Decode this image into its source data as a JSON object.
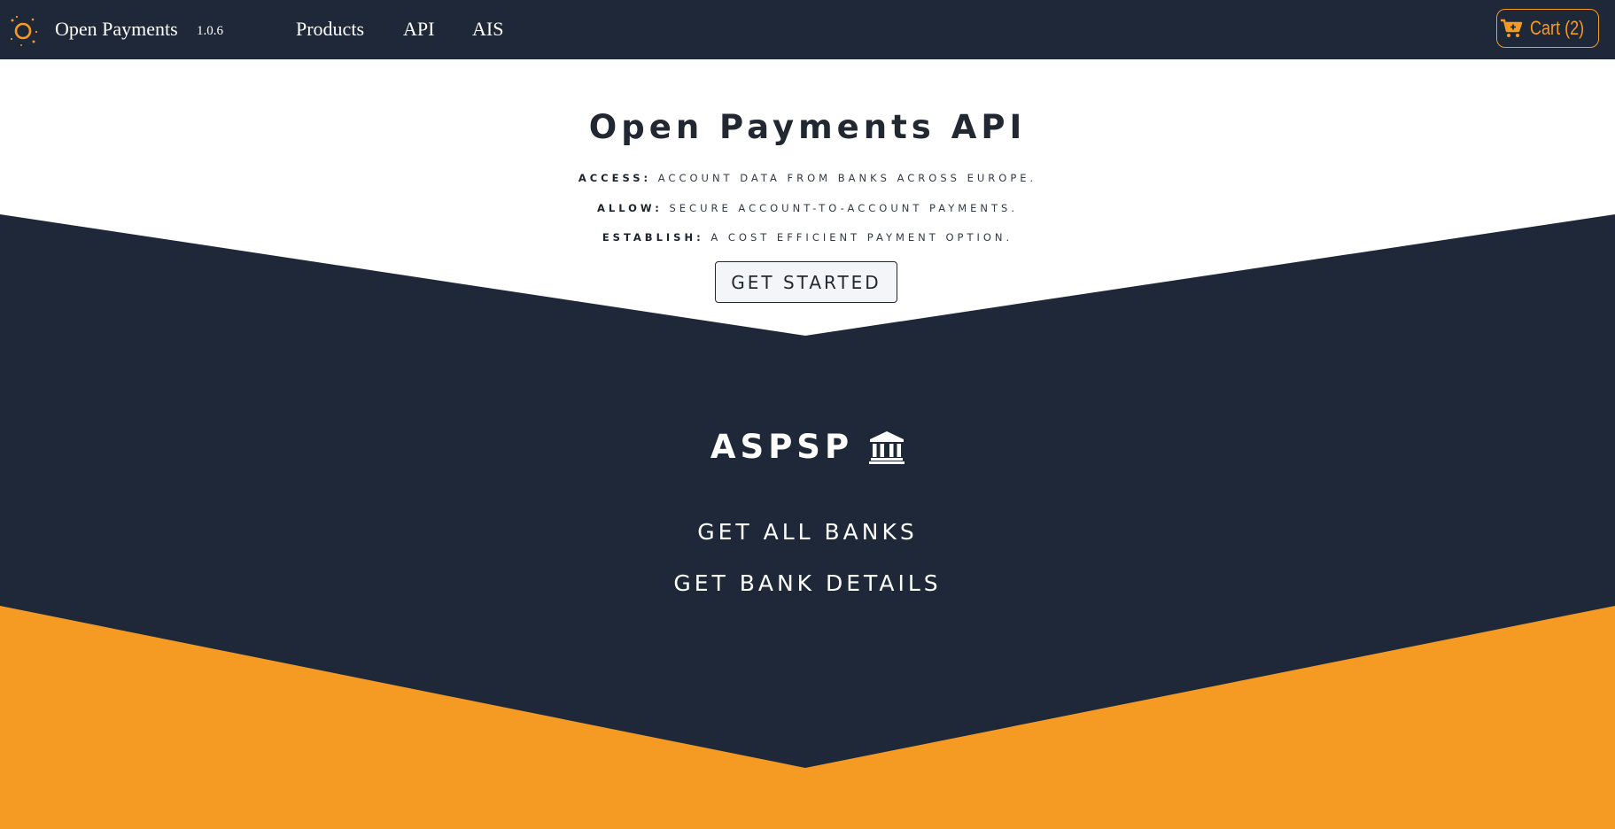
{
  "navbar": {
    "brand_name": "Open Payments",
    "brand_version": "1.0.6",
    "links": [
      "Products",
      "API",
      "AIS"
    ],
    "cart_label": "Cart (2)",
    "logo_icon": "open-payments-logo-icon",
    "cart_icon": "shopping-cart-icon"
  },
  "hero": {
    "title": "Open Payments API",
    "lines": [
      {
        "label": "ACCESS:",
        "text": "ACCOUNT DATA FROM BANKS ACROSS EUROPE."
      },
      {
        "label": "ALLOW:",
        "text": "SECURE ACCOUNT-TO-ACCOUNT PAYMENTS."
      },
      {
        "label": "ESTABLISH:",
        "text": "A COST EFFICIENT PAYMENT OPTION."
      }
    ],
    "button_label": "GET STARTED"
  },
  "aspsp": {
    "heading": "ASPSP",
    "heading_icon": "bank-icon",
    "links": [
      "GET ALL BANKS",
      "GET BANK DETAILS"
    ]
  },
  "colors": {
    "navy": "#1e2838",
    "orange": "#f59a23",
    "white": "#ffffff"
  }
}
